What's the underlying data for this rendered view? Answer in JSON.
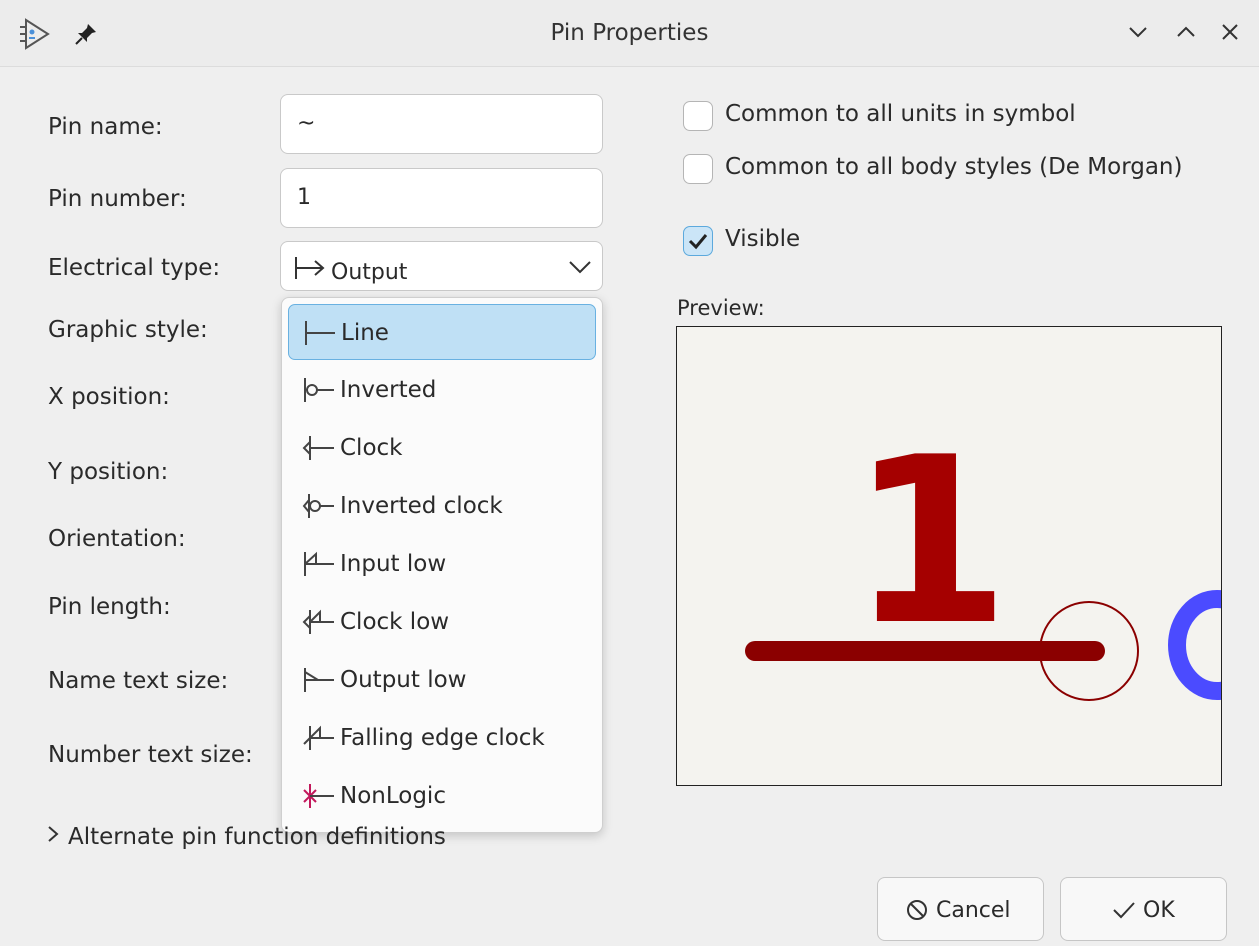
{
  "window": {
    "title": "Pin Properties"
  },
  "fields": {
    "pin_name": {
      "label": "Pin name:",
      "value": "~"
    },
    "pin_number": {
      "label": "Pin number:",
      "value": "1"
    },
    "electrical_type": {
      "label": "Electrical type:",
      "value": "Output"
    },
    "graphic_style": {
      "label": "Graphic style:"
    },
    "x_position": {
      "label": "X position:"
    },
    "y_position": {
      "label": "Y position:"
    },
    "orientation": {
      "label": "Orientation:"
    },
    "pin_length": {
      "label": "Pin length:"
    },
    "name_text_size": {
      "label": "Name text size:"
    },
    "number_text_size": {
      "label": "Number text size:"
    }
  },
  "graphic_style_options": [
    {
      "label": "Line",
      "icon": "line-pin-icon",
      "selected": true
    },
    {
      "label": "Inverted",
      "icon": "inverted-pin-icon"
    },
    {
      "label": "Clock",
      "icon": "clock-pin-icon"
    },
    {
      "label": "Inverted clock",
      "icon": "inverted-clock-pin-icon"
    },
    {
      "label": "Input low",
      "icon": "input-low-pin-icon"
    },
    {
      "label": "Clock low",
      "icon": "clock-low-pin-icon"
    },
    {
      "label": "Output low",
      "icon": "output-low-pin-icon"
    },
    {
      "label": "Falling edge clock",
      "icon": "falling-edge-clock-pin-icon"
    },
    {
      "label": "NonLogic",
      "icon": "nonlogic-pin-icon"
    }
  ],
  "checkboxes": {
    "common_units": {
      "label": "Common to all units in symbol",
      "checked": false
    },
    "common_body_styles": {
      "label": "Common to all body styles (De Morgan)",
      "checked": false
    },
    "visible": {
      "label": "Visible",
      "checked": true
    }
  },
  "preview": {
    "label": "Preview:",
    "pin_number_text": "1"
  },
  "alternate": {
    "label": "Alternate pin function definitions"
  },
  "buttons": {
    "cancel": "Cancel",
    "ok": "OK"
  },
  "colors": {
    "selection_bg": "#bfe0f5",
    "pin": "#8b0000",
    "name_text": "#4b4bff"
  }
}
